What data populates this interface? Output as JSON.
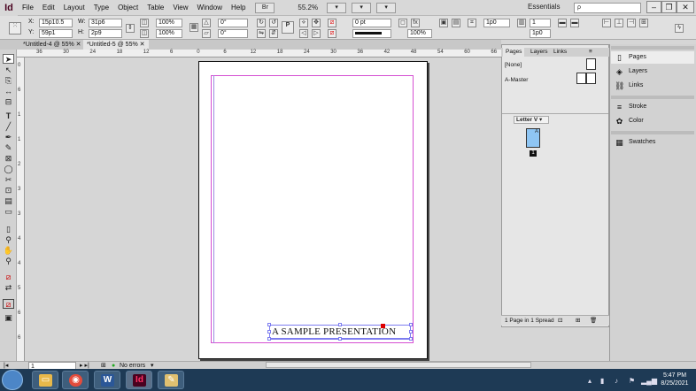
{
  "app": {
    "logo": "Id"
  },
  "menubar": {
    "items": [
      "File",
      "Edit",
      "Layout",
      "Type",
      "Object",
      "Table",
      "View",
      "Window",
      "Help"
    ],
    "zoom": "55.2%",
    "workspace": "Essentials",
    "search_placeholder": "ρ"
  },
  "control": {
    "x_label": "X:",
    "x_value": "15p10.5",
    "y_label": "Y:",
    "y_value": "59p1",
    "w_label": "W:",
    "w_value": "31p6",
    "h_label": "H:",
    "h_value": "2p9",
    "scale_x": "100%",
    "scale_y": "100%",
    "rotate": "0°",
    "shear": "0°",
    "stroke_weight": "0 pt",
    "opacity": "100%",
    "gap": "1p0",
    "columns": "1",
    "gutter": "1p0"
  },
  "tabs": [
    {
      "label": "*Untitled-4 @ 55%"
    },
    {
      "label": "*Untitled-5 @ 55%"
    }
  ],
  "ruler": {
    "h_ticks": [
      "36",
      "30",
      "24",
      "18",
      "12",
      "6",
      "0",
      "6",
      "12",
      "18",
      "24",
      "30",
      "36",
      "42",
      "48",
      "54",
      "60",
      "66"
    ],
    "v_ticks": [
      "0",
      "6",
      "1",
      "1",
      "2",
      "3",
      "3",
      "4",
      "4",
      "5",
      "6",
      "6"
    ]
  },
  "document": {
    "frame_text": "A SAMPLE PRESENTATION"
  },
  "pages_panel": {
    "tabs": [
      "Pages",
      "Layers",
      "Links"
    ],
    "none_label": "[None]",
    "master_label": "A-Master",
    "spread_label": "Letter V",
    "thumb_master": "A",
    "page_number": "1",
    "footer": "1 Page in 1 Spread"
  },
  "dock": {
    "items": [
      "Pages",
      "Layers",
      "Links",
      "Stroke",
      "Color",
      "Swatches"
    ]
  },
  "status": {
    "page_field": "1",
    "preflight": "No errors"
  },
  "taskbar": {
    "time": "5:47 PM",
    "date": "8/25/2021"
  }
}
